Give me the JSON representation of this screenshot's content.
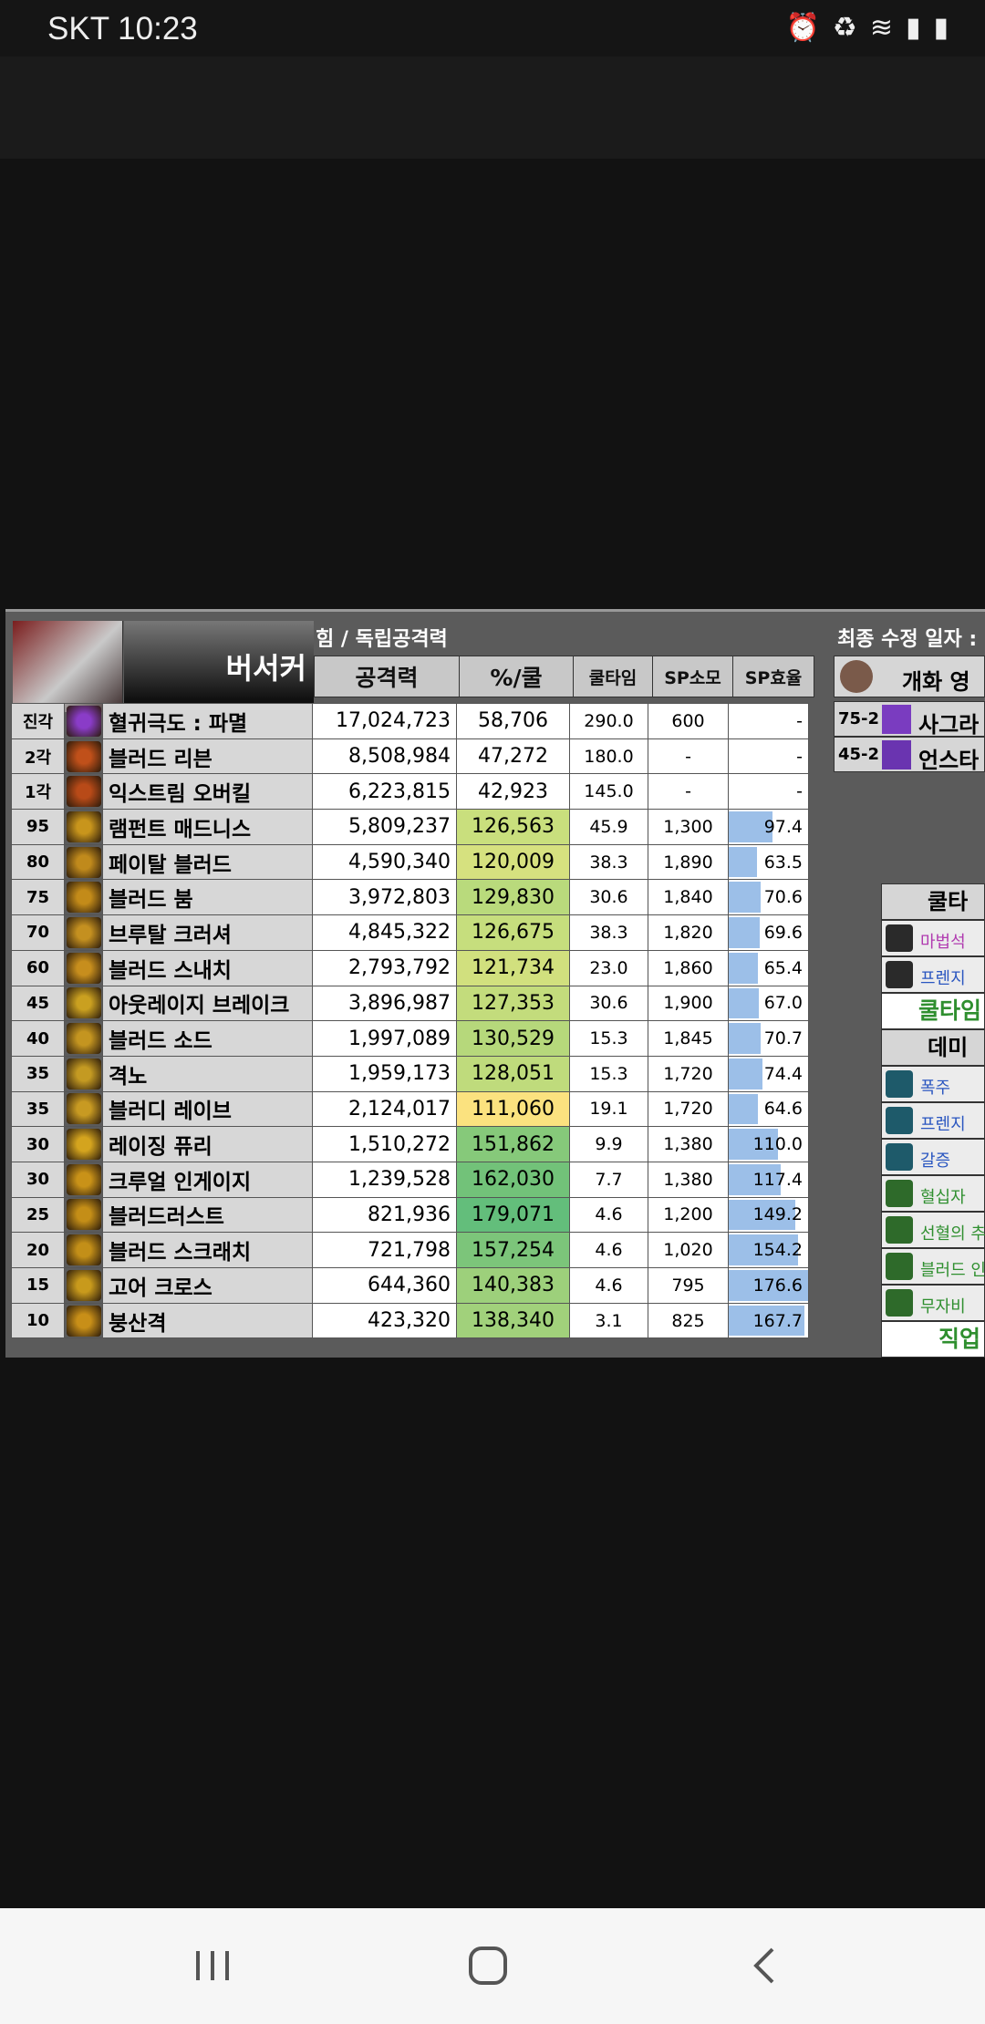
{
  "status": {
    "carrier_time": "SKT 10:23"
  },
  "sheet": {
    "class_name": "버서커",
    "stat_type": "힘 / 독립공격력",
    "modified_label": "최종 수정 일자 :",
    "headers": {
      "attack": "공격력",
      "pct": "%/쿨",
      "cooltime": "쿨타임",
      "sp_cost": "SP소모",
      "sp_eff": "SP효율"
    },
    "rows": [
      {
        "lvl": "진각",
        "name": "혈귀극도 : 파멸",
        "atk": "17,024,723",
        "pct": "58,706",
        "ct": "290.0",
        "sp": "600",
        "eff": "-",
        "eff_frac": 0,
        "pct_color": "#ffffff",
        "icon_color": "#8a3cc8"
      },
      {
        "lvl": "2각",
        "name": "블러드 리븐",
        "atk": "8,508,984",
        "pct": "47,272",
        "ct": "180.0",
        "sp": "-",
        "eff": "-",
        "eff_frac": 0,
        "pct_color": "#ffffff",
        "icon_color": "#c0501a"
      },
      {
        "lvl": "1각",
        "name": "익스트림 오버킬",
        "atk": "6,223,815",
        "pct": "42,923",
        "ct": "145.0",
        "sp": "-",
        "eff": "-",
        "eff_frac": 0,
        "pct_color": "#ffffff",
        "icon_color": "#b84a18"
      },
      {
        "lvl": "95",
        "name": "램펀트 매드니스",
        "atk": "5,809,237",
        "pct": "126,563",
        "ct": "45.9",
        "sp": "1,300",
        "eff": "97.4",
        "eff_frac": 0.55,
        "pct_color": "#c9df7d",
        "icon_color": "#c8951c"
      },
      {
        "lvl": "80",
        "name": "페이탈 블러드",
        "atk": "4,590,340",
        "pct": "120,009",
        "ct": "38.3",
        "sp": "1,890",
        "eff": "63.5",
        "eff_frac": 0.36,
        "pct_color": "#d6e17f",
        "icon_color": "#c08a1c"
      },
      {
        "lvl": "75",
        "name": "블러드 붐",
        "atk": "3,972,803",
        "pct": "129,830",
        "ct": "30.6",
        "sp": "1,840",
        "eff": "70.6",
        "eff_frac": 0.4,
        "pct_color": "#b9da7c",
        "icon_color": "#c38b19"
      },
      {
        "lvl": "70",
        "name": "브루탈 크러셔",
        "atk": "4,845,322",
        "pct": "126,675",
        "ct": "38.3",
        "sp": "1,820",
        "eff": "69.6",
        "eff_frac": 0.39,
        "pct_color": "#c6de7d",
        "icon_color": "#c49020"
      },
      {
        "lvl": "60",
        "name": "블러드 스내치",
        "atk": "2,793,792",
        "pct": "121,734",
        "ct": "23.0",
        "sp": "1,860",
        "eff": "65.4",
        "eff_frac": 0.37,
        "pct_color": "#d1e07e",
        "icon_color": "#c78e1d"
      },
      {
        "lvl": "45",
        "name": "아웃레이지 브레이크",
        "atk": "3,896,987",
        "pct": "127,353",
        "ct": "30.6",
        "sp": "1,900",
        "eff": "67.0",
        "eff_frac": 0.38,
        "pct_color": "#c3dc7c",
        "icon_color": "#caa020"
      },
      {
        "lvl": "40",
        "name": "블러드 소드",
        "atk": "1,997,089",
        "pct": "130,529",
        "ct": "15.3",
        "sp": "1,845",
        "eff": "70.7",
        "eff_frac": 0.4,
        "pct_color": "#b6d87b",
        "icon_color": "#c49520"
      },
      {
        "lvl": "35",
        "name": "격노",
        "atk": "1,959,173",
        "pct": "128,051",
        "ct": "15.3",
        "sp": "1,720",
        "eff": "74.4",
        "eff_frac": 0.42,
        "pct_color": "#bfdb7c",
        "icon_color": "#c49a22"
      },
      {
        "lvl": "35",
        "name": "블러디 레이브",
        "atk": "2,124,017",
        "pct": "111,060",
        "ct": "19.1",
        "sp": "1,720",
        "eff": "64.6",
        "eff_frac": 0.37,
        "pct_color": "#fbe27f",
        "icon_color": "#c89a22"
      },
      {
        "lvl": "30",
        "name": "레이징 퓨리",
        "atk": "1,510,272",
        "pct": "151,862",
        "ct": "9.9",
        "sp": "1,380",
        "eff": "110.0",
        "eff_frac": 0.62,
        "pct_color": "#86c97a",
        "icon_color": "#d4a41e"
      },
      {
        "lvl": "30",
        "name": "크루얼 인게이지",
        "atk": "1,239,528",
        "pct": "162,030",
        "ct": "7.7",
        "sp": "1,380",
        "eff": "117.4",
        "eff_frac": 0.66,
        "pct_color": "#72c279",
        "icon_color": "#c99218"
      },
      {
        "lvl": "25",
        "name": "블러드러스트",
        "atk": "821,936",
        "pct": "179,071",
        "ct": "4.6",
        "sp": "1,200",
        "eff": "149.2",
        "eff_frac": 0.84,
        "pct_color": "#63be7b",
        "icon_color": "#c48e17"
      },
      {
        "lvl": "20",
        "name": "블러드 스크래치",
        "atk": "721,798",
        "pct": "157,254",
        "ct": "4.6",
        "sp": "1,020",
        "eff": "154.2",
        "eff_frac": 0.87,
        "pct_color": "#7cc57a",
        "icon_color": "#c38f18"
      },
      {
        "lvl": "15",
        "name": "고어 크로스",
        "atk": "644,360",
        "pct": "140,383",
        "ct": "4.6",
        "sp": "795",
        "eff": "176.6",
        "eff_frac": 1.0,
        "pct_color": "#9dd07b",
        "icon_color": "#c89a1c"
      },
      {
        "lvl": "10",
        "name": "붕산격",
        "atk": "423,320",
        "pct": "138,340",
        "ct": "3.1",
        "sp": "825",
        "eff": "167.7",
        "eff_frac": 0.95,
        "pct_color": "#a1d17b",
        "icon_color": "#c88f18"
      }
    ],
    "right": {
      "awaken_label": "개화 영",
      "awaken_items": [
        {
          "lvl": "75-2",
          "name": "사그라"
        },
        {
          "lvl": "45-2",
          "name": "언스타"
        }
      ],
      "cool_header": "쿨타임",
      "cool_items": [
        "마법석",
        "프렌지"
      ],
      "cool_footer": "쿨타임",
      "dmg_header": "데미지",
      "dmg_items": [
        "폭주",
        "프렌지",
        "갈증",
        "혈십자",
        "선혈의 추",
        "블러드 인",
        "무자비"
      ],
      "job_footer": "직업"
    }
  }
}
